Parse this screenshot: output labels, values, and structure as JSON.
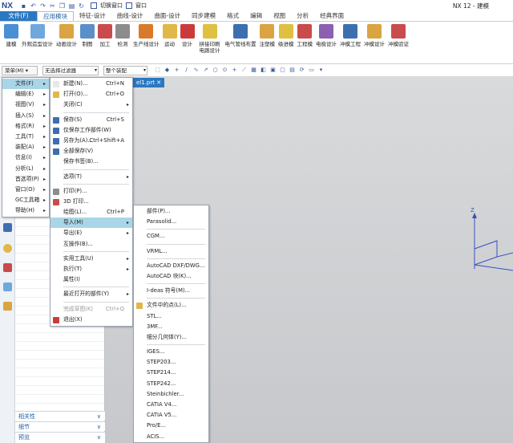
{
  "titlebar": {
    "logo": "NX",
    "switch_window": "切换窗口",
    "window": "窗口",
    "app_title": "NX 12 - 建模"
  },
  "tabs": [
    "文件(F)",
    "应用模块",
    "特征-设计",
    "曲线-设计",
    "曲面-设计",
    "同步建模",
    "格式",
    "编辑",
    "视图",
    "分析",
    "经典界面"
  ],
  "ribbon": [
    {
      "label": "建模",
      "color": "#4a8fd4"
    },
    {
      "label": "外观造型设计",
      "color": "#6fa8dc"
    },
    {
      "label": "动画设计",
      "color": "#d9a441"
    },
    {
      "label": "制图",
      "color": "#5b8fc9"
    },
    {
      "label": "加工",
      "color": "#c94b4b"
    },
    {
      "label": "检测",
      "color": "#8c8c8c"
    },
    {
      "label": "生产线设计",
      "color": "#d97a2b"
    },
    {
      "label": "运动",
      "color": "#e0b84a"
    },
    {
      "label": "设计",
      "color": "#cc3b3b"
    },
    {
      "label": "拼接印刷电路设计",
      "color": "#e0c040"
    },
    {
      "label": "电气管线布置",
      "color": "#3d6fb0"
    },
    {
      "label": "注塑模",
      "color": "#d9a441"
    },
    {
      "label": "级进模",
      "color": "#e0c040"
    },
    {
      "label": "工程模",
      "color": "#c94b4b"
    },
    {
      "label": "电极设计",
      "color": "#8c5fb0"
    },
    {
      "label": "冲模工程",
      "color": "#3d6fb0"
    },
    {
      "label": "冲模设计",
      "color": "#d9a441"
    },
    {
      "label": "冲模验证",
      "color": "#c94b4b"
    }
  ],
  "toolbar": {
    "menu_label": "菜单(M) ▾",
    "filter": "无选择过滤器",
    "assembly": "整个装配"
  },
  "doc_tab": "el1.prt",
  "nav_sections": [
    "相关性",
    "细节",
    "预览"
  ],
  "main_menu": [
    {
      "label": "文件(F)",
      "arrow": "▸",
      "highlight": true
    },
    {
      "label": "编辑(E)",
      "arrow": "▸"
    },
    {
      "label": "视图(V)",
      "arrow": "▸"
    },
    {
      "label": "插入(S)",
      "arrow": "▸"
    },
    {
      "label": "格式(R)",
      "arrow": "▸"
    },
    {
      "label": "工具(T)",
      "arrow": "▸"
    },
    {
      "label": "装配(A)",
      "arrow": "▸"
    },
    {
      "label": "信息(I)",
      "arrow": "▸"
    },
    {
      "label": "分析(L)",
      "arrow": "▸"
    },
    {
      "label": "首选项(P)",
      "arrow": "▸"
    },
    {
      "label": "窗口(O)",
      "arrow": "▸"
    },
    {
      "label": "GC工具箱",
      "arrow": "▸"
    },
    {
      "label": "帮助(H)",
      "arrow": "▸"
    }
  ],
  "file_menu": [
    {
      "label": "新建(N)...",
      "shortcut": "Ctrl+N",
      "icon": "#e8e8e8"
    },
    {
      "label": "打开(O)...",
      "shortcut": "Ctrl+O",
      "icon": "#e0b84a"
    },
    {
      "label": "关闭(C)",
      "arrow": "▸"
    },
    {
      "sep": true
    },
    {
      "label": "保存(S)",
      "shortcut": "Ctrl+S",
      "icon": "#3d6fb0"
    },
    {
      "label": "仅保存工作部件(W)",
      "icon": "#3d6fb0"
    },
    {
      "label": "另存为(A)...",
      "shortcut": "Ctrl+Shift+A",
      "icon": "#3d6fb0"
    },
    {
      "label": "全部保存(V)",
      "icon": "#3d6fb0"
    },
    {
      "label": "保存书签(B)..."
    },
    {
      "sep": true
    },
    {
      "label": "选项(T)",
      "arrow": "▸"
    },
    {
      "sep": true
    },
    {
      "label": "打印(P)...",
      "icon": "#8c8c8c"
    },
    {
      "label": "3D 打印...",
      "icon": "#c94b4b"
    },
    {
      "label": "绘图(L)...",
      "shortcut": "Ctrl+P"
    },
    {
      "label": "导入(M)",
      "arrow": "▸",
      "highlight": true
    },
    {
      "label": "导出(E)",
      "arrow": "▸"
    },
    {
      "label": "互操作(B)..."
    },
    {
      "sep": true
    },
    {
      "label": "实用工具(U)",
      "arrow": "▸"
    },
    {
      "label": "执行(T)",
      "arrow": "▸"
    },
    {
      "label": "属性(I)"
    },
    {
      "sep": true
    },
    {
      "label": "最近打开的部件(Y)",
      "arrow": "▸"
    },
    {
      "sep": true
    },
    {
      "label": "完成草图(K)",
      "shortcut": "Ctrl+Q",
      "disabled": true
    },
    {
      "label": "退出(X)",
      "icon": "#cc3b3b"
    }
  ],
  "import_menu": [
    {
      "label": "部件(P)..."
    },
    {
      "label": "Parasolid..."
    },
    {
      "sep": true
    },
    {
      "label": "CGM..."
    },
    {
      "sep": true
    },
    {
      "label": "VRML..."
    },
    {
      "sep": true
    },
    {
      "label": "AutoCAD DXF/DWG..."
    },
    {
      "label": "AutoCAD 块(K)..."
    },
    {
      "sep": true
    },
    {
      "label": "I-deas 符号(M)..."
    },
    {
      "sep": true
    },
    {
      "label": "文件中的点(L)...",
      "icon": "#e0b84a"
    },
    {
      "label": "STL..."
    },
    {
      "label": "3MF..."
    },
    {
      "label": "细分几何体(Y)..."
    },
    {
      "sep": true
    },
    {
      "label": "IGES..."
    },
    {
      "label": "STEP203..."
    },
    {
      "label": "STEP214..."
    },
    {
      "label": "STEP242..."
    },
    {
      "label": "Steinbichler..."
    },
    {
      "label": "CATIA V4..."
    },
    {
      "label": "CATIA V5..."
    },
    {
      "label": "Pro/E..."
    },
    {
      "label": "ACIS..."
    }
  ],
  "axes": {
    "z": "Z"
  }
}
